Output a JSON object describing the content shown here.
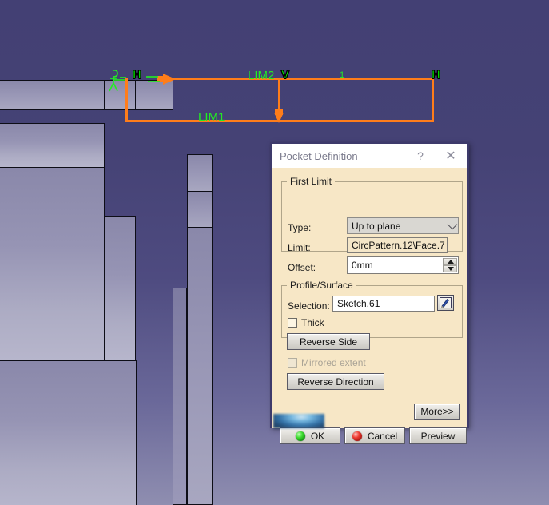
{
  "viewport": {
    "background_color": "#45427a",
    "sketch_color": "#ff7d1a",
    "annotation_color": "#22ee22",
    "labels": {
      "lim1": "LIM1",
      "lim2": "LIM2",
      "h_left": "H",
      "h_right": "H",
      "v": "V",
      "one": "1"
    }
  },
  "dialog": {
    "title": "Pocket Definition",
    "help_label": "?",
    "close_label": "✕",
    "first_limit": {
      "legend": "First Limit",
      "type_label": "Type:",
      "type_value": "Up to plane",
      "limit_label": "Limit:",
      "limit_value": "CircPattern.12\\Face.7",
      "offset_label": "Offset:",
      "offset_value": "0mm"
    },
    "profile_surface": {
      "legend": "Profile/Surface",
      "selection_label": "Selection:",
      "selection_value": "Sketch.61",
      "sketch_icon_name": "sketch-pencil-icon",
      "thick_label": "Thick",
      "thick_checked": false,
      "reverse_side_label": "Reverse Side"
    },
    "mirrored_extent_label": "Mirrored extent",
    "mirrored_extent_enabled": false,
    "reverse_direction_label": "Reverse Direction",
    "more_label": "More>>",
    "ok_label": "OK",
    "cancel_label": "Cancel",
    "preview_label": "Preview"
  }
}
